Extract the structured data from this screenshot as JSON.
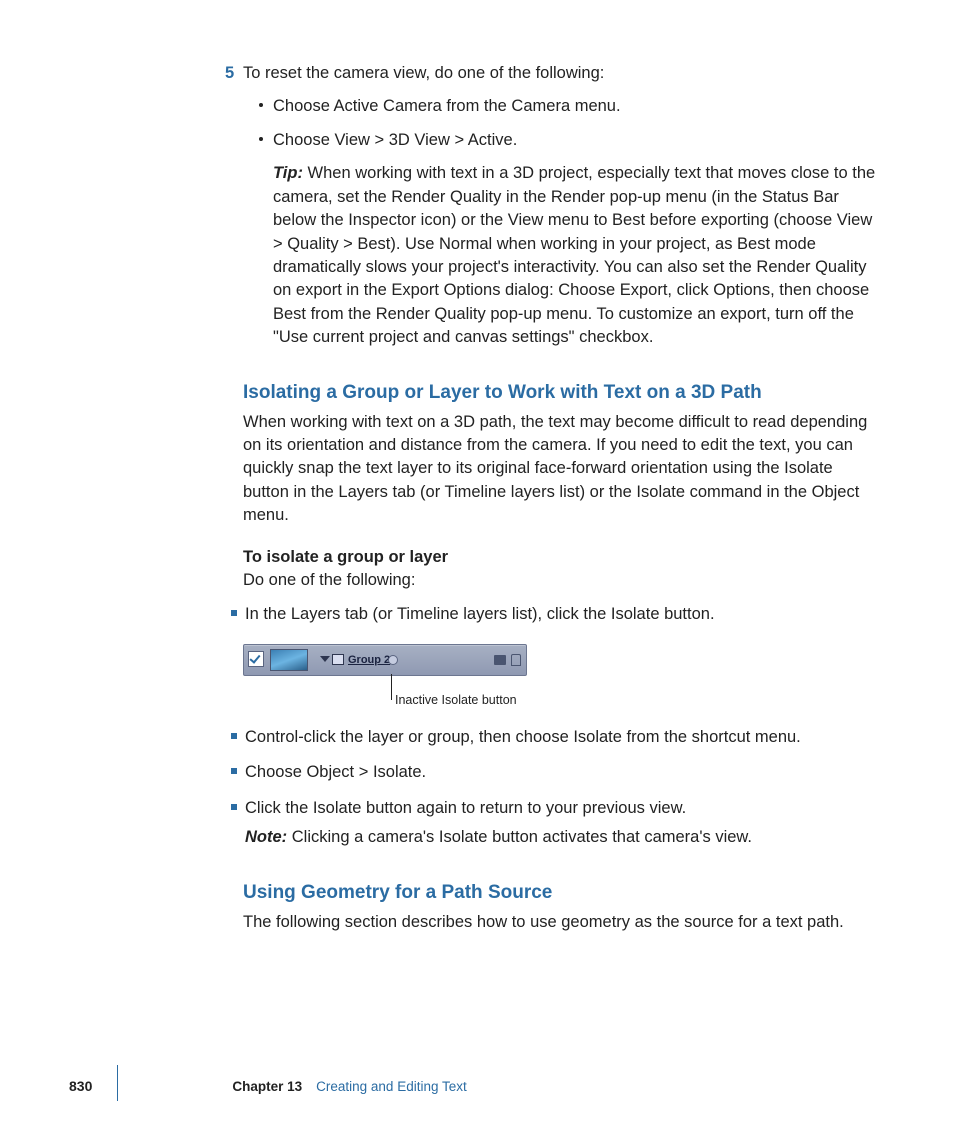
{
  "step": {
    "num": "5",
    "text": "To reset the camera view, do one of the following:",
    "sub": [
      "Choose Active Camera from the Camera menu.",
      "Choose View > 3D View > Active."
    ],
    "tip_label": "Tip:",
    "tip_text": " When working with text in a 3D project, especially text that moves close to the camera, set the Render Quality in the Render pop-up menu (in the Status Bar below the Inspector icon) or the View menu to Best before exporting (choose View > Quality > Best). Use Normal when working in your project, as Best mode dramatically slows your project's interactivity. You can also set the Render Quality on export in the Export Options dialog: Choose Export, click Options, then choose Best from the Render Quality pop-up menu. To customize an export, turn off the \"Use current project and canvas settings\" checkbox."
  },
  "section1": {
    "heading": "Isolating a Group or Layer to Work with Text on a 3D Path",
    "para": "When working with text on a 3D path, the text may become difficult to read depending on its orientation and distance from the camera. If you need to edit the text, you can quickly snap the text layer to its original face-forward orientation using the Isolate button in the Layers tab (or Timeline layers list) or the Isolate command in the Object menu.",
    "lead": "To isolate a group or layer",
    "do_one": "Do one of the following:",
    "items_a": [
      "In the Layers tab (or Timeline layers list), click the Isolate button."
    ],
    "figure": {
      "name": "Group 2",
      "callout": "Inactive Isolate button"
    },
    "items_b": [
      "Control-click the layer or group, then choose Isolate from the shortcut menu.",
      "Choose Object > Isolate.",
      "Click the Isolate button again to return to your previous view."
    ],
    "note_label": "Note:",
    "note_text": " Clicking a camera's Isolate button activates that camera's view."
  },
  "section2": {
    "heading": "Using Geometry for a Path Source",
    "para": "The following section describes how to use geometry as the source for a text path."
  },
  "footer": {
    "page": "830",
    "chapter": "Chapter 13",
    "title": "Creating and Editing Text"
  }
}
